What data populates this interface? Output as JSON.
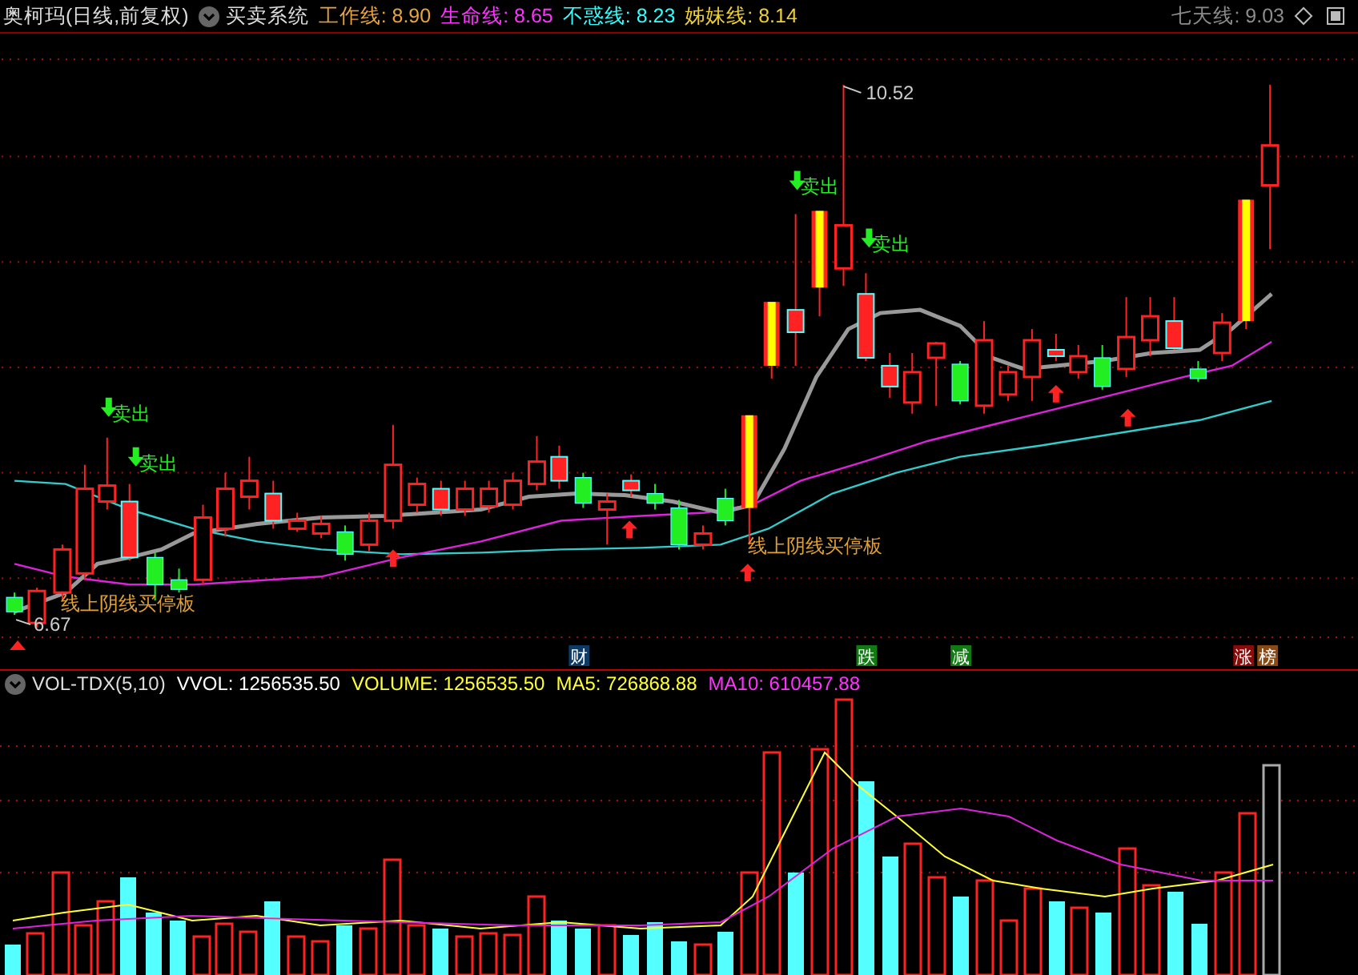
{
  "header": {
    "symbol": "奥柯玛(日线,前复权)",
    "indicator": "买卖系统",
    "lines": [
      {
        "label": "工作线: 8.90",
        "color": "#e8a33c"
      },
      {
        "label": "生命线: 8.65",
        "color": "#ff33ff"
      },
      {
        "label": "不惑线: 8.23",
        "color": "#33ffff"
      },
      {
        "label": "姊妹线: 8.14",
        "color": "#f0d030"
      }
    ],
    "extra_line": {
      "label": "七天线: 9.03",
      "color": "#8c8c8c"
    }
  },
  "price_chart": {
    "high_label": "10.52",
    "low_label": "6.67",
    "signals": [
      {
        "kind": "sell",
        "label": "卖出"
      },
      {
        "kind": "sell",
        "label": "卖出"
      },
      {
        "kind": "sell",
        "label": "卖出"
      },
      {
        "kind": "sell",
        "label": "卖出"
      },
      {
        "kind": "buy",
        "label": "线上阴线买停板"
      },
      {
        "kind": "buy",
        "label": "线上阴线买停板"
      }
    ],
    "markers": [
      {
        "label": "财",
        "color": "#0d3b66"
      },
      {
        "label": "跌",
        "color": "#127a12"
      },
      {
        "label": "减",
        "color": "#127a12"
      },
      {
        "label": "涨",
        "color": "#8b0a0a"
      },
      {
        "label": "榜",
        "color": "#8b4a12"
      }
    ]
  },
  "volume": {
    "title": "VOL-TDX(5,10)",
    "values": [
      {
        "label": "VVOL: 1256535.50",
        "color": "#ffffff"
      },
      {
        "label": "VOLUME: 1256535.50",
        "color": "#ffff33"
      },
      {
        "label": "MA5: 726868.88",
        "color": "#ffff33"
      },
      {
        "label": "MA10: 610457.88",
        "color": "#ff33ff"
      }
    ]
  }
}
